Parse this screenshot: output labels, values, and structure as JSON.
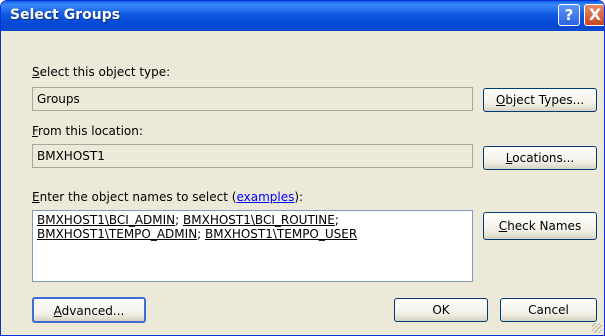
{
  "dialog": {
    "title": "Select Groups",
    "help_label": "?",
    "close_label": "X"
  },
  "object_type": {
    "label_first": "S",
    "label_rest": "elect this object type:",
    "value": "Groups",
    "button_first": "O",
    "button_rest": "bject Types..."
  },
  "location": {
    "label_first": "F",
    "label_rest": "rom this location:",
    "value": "BMXHOST1",
    "button_first": "L",
    "button_rest": "ocations..."
  },
  "names": {
    "label_first": "E",
    "label_rest": "nter the object names to select (",
    "link": "examples",
    "label_end": "):",
    "entries": [
      "BMXHOST1\\BCI_ADMIN",
      "BMXHOST1\\BCI_ROUTINE",
      "BMXHOST1\\TEMPO_ADMIN",
      "BMXHOST1\\TEMPO_USER"
    ],
    "separator": "; ",
    "check_first": "C",
    "check_rest": "heck Names"
  },
  "footer": {
    "advanced_first": "A",
    "advanced_rest": "dvanced...",
    "ok": "OK",
    "cancel": "Cancel"
  }
}
